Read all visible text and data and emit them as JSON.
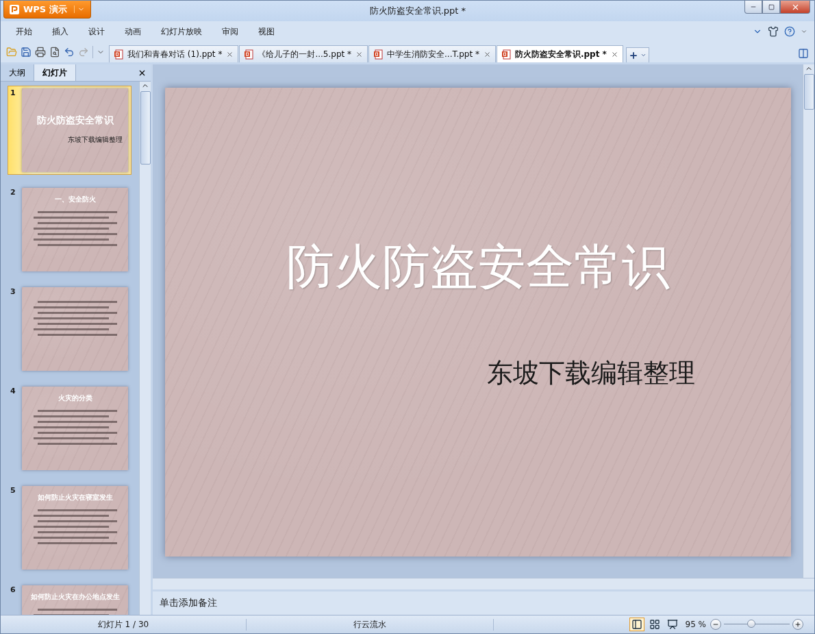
{
  "window": {
    "app_button": "WPS 演示",
    "title": "防火防盗安全常识.ppt *"
  },
  "menu": [
    "开始",
    "插入",
    "设计",
    "动画",
    "幻灯片放映",
    "审阅",
    "视图"
  ],
  "doc_tabs": [
    {
      "label": "我们和青春对话 (1).ppt *",
      "selected": false
    },
    {
      "label": "《给儿子的一封...5.ppt *",
      "selected": false
    },
    {
      "label": "中学生消防安全...T.ppt *",
      "selected": false
    },
    {
      "label": "防火防盗安全常识.ppt *",
      "selected": true
    }
  ],
  "panel_tabs": [
    {
      "label": "大纲",
      "selected": false
    },
    {
      "label": "幻灯片",
      "selected": true
    }
  ],
  "slides": [
    {
      "number": "1",
      "selected": true,
      "kind": "title",
      "title": "防火防盗安全常识",
      "subtitle": "东坡下载编辑整理"
    },
    {
      "number": "2",
      "selected": false,
      "kind": "content",
      "title": "一、安全防火"
    },
    {
      "number": "3",
      "selected": false,
      "kind": "content"
    },
    {
      "number": "4",
      "selected": false,
      "kind": "content",
      "title": "火灾的分类"
    },
    {
      "number": "5",
      "selected": false,
      "kind": "content",
      "title": "如何防止火灾在寝室发生"
    },
    {
      "number": "6",
      "selected": false,
      "kind": "content",
      "title": "如何防止火灾在办公地点发生"
    }
  ],
  "current_slide": {
    "title": "防火防盗安全常识",
    "subtitle": "东坡下载编辑整理"
  },
  "notes": {
    "placeholder": "单击添加备注"
  },
  "status_bar": {
    "slide_count": "幻灯片 1 / 30",
    "theme": "行云流水",
    "views": [
      {
        "kind": "normal",
        "selected": true
      },
      {
        "kind": "sorter",
        "selected": false
      },
      {
        "kind": "show",
        "selected": false
      }
    ],
    "zoom": "95 %",
    "zoom_slider": {
      "level": 0.42
    }
  }
}
